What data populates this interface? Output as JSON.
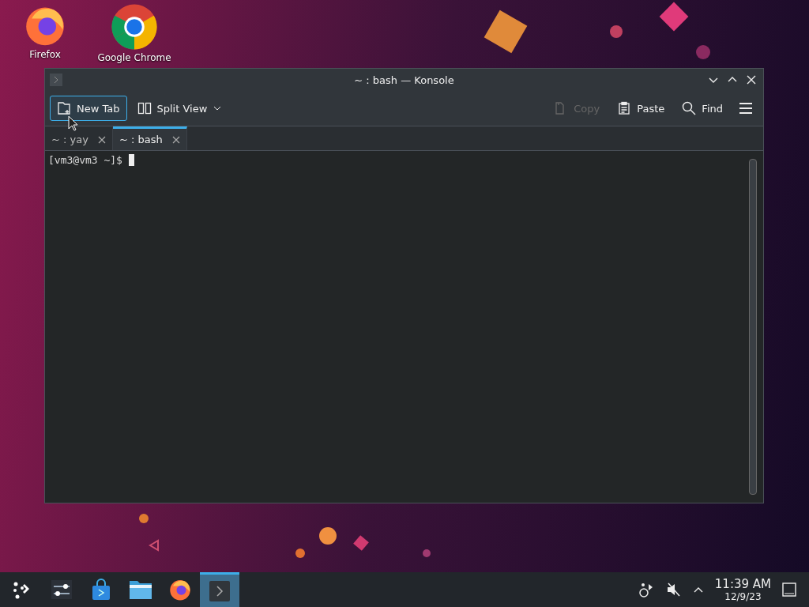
{
  "desktop_icons": [
    {
      "kind": "firefox",
      "label": "Firefox"
    },
    {
      "kind": "chrome",
      "label": "Google Chrome"
    }
  ],
  "window": {
    "title": "~ : bash — Konsole"
  },
  "toolbar": {
    "left": [
      {
        "kind": "newtab",
        "label": "New Tab",
        "focused": true
      },
      {
        "kind": "split",
        "label": "Split View",
        "focused": false
      }
    ],
    "right": [
      {
        "kind": "copy",
        "label": "Copy",
        "disabled": true
      },
      {
        "kind": "paste",
        "label": "Paste",
        "disabled": false
      },
      {
        "kind": "find",
        "label": "Find",
        "disabled": false
      }
    ]
  },
  "tabs": [
    {
      "label": "~ : yay",
      "selected": false
    },
    {
      "label": "~ : bash",
      "selected": true
    }
  ],
  "terminal": {
    "prompt": "[vm3@vm3 ~]$"
  },
  "taskbar": {
    "apps": [
      {
        "kind": "launcher",
        "selected": false
      },
      {
        "kind": "settings",
        "selected": false
      },
      {
        "kind": "store",
        "selected": false
      },
      {
        "kind": "files",
        "selected": false
      },
      {
        "kind": "firefox",
        "selected": false
      },
      {
        "kind": "konsole",
        "selected": true
      }
    ],
    "time": "11:39 AM",
    "date": "12/9/23"
  }
}
